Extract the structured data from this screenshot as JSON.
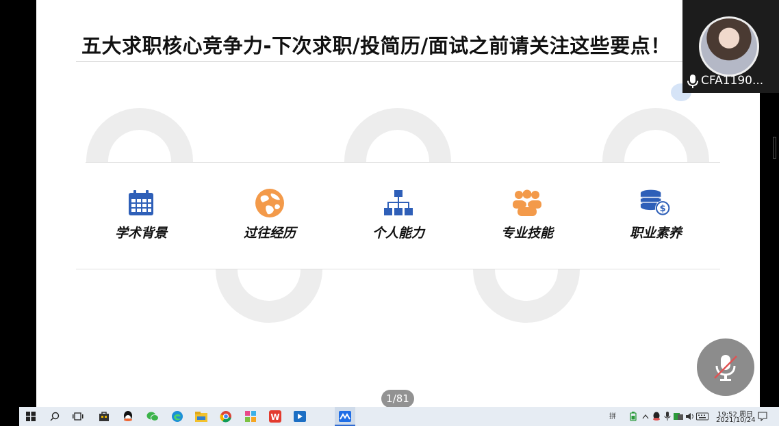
{
  "slide": {
    "title": "五大求职核心竞争力-下次求职/投简历/面试之前请关注这些要点！",
    "competencies": [
      {
        "label": "学术背景",
        "icon": "calendar-icon",
        "color": "#2e5fb8"
      },
      {
        "label": "过往经历",
        "icon": "globe-icon",
        "color": "#f39a4a"
      },
      {
        "label": "个人能力",
        "icon": "org-chart-icon",
        "color": "#2e5fb8"
      },
      {
        "label": "专业技能",
        "icon": "team-icon",
        "color": "#f39a4a"
      },
      {
        "label": "职业素养",
        "icon": "coin-stack-dollar-icon",
        "color": "#2e5fb8"
      }
    ],
    "page_counter": "1/81"
  },
  "video": {
    "participant_name": "CFA1190..."
  },
  "taskbar": {
    "ime": "拼",
    "time": "19:52 周日",
    "date": "2021/10/24"
  }
}
